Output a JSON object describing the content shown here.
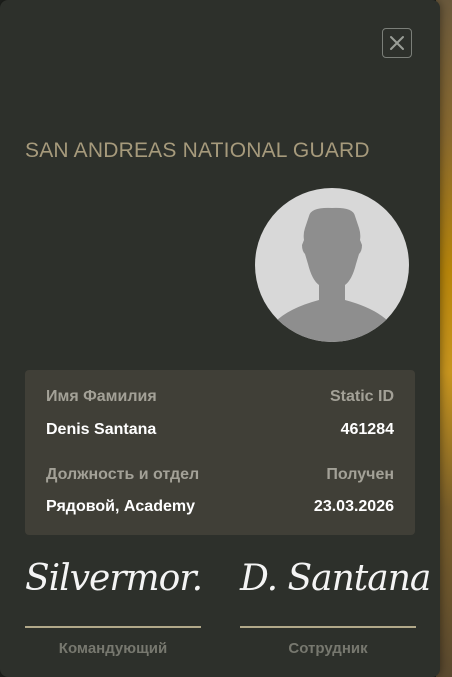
{
  "header": {
    "title": "SAN ANDREAS NATIONAL GUARD",
    "close_icon": "close-icon"
  },
  "photo": {
    "icon": "person-silhouette-icon"
  },
  "info": {
    "name_label": "Имя Фамилия",
    "name_value": "Denis Santana",
    "static_id_label": "Static ID",
    "static_id_value": "461284",
    "position_label": "Должность и отдел",
    "position_value": "Рядовой, Academy",
    "received_label": "Получен",
    "received_value": "23.03.2026"
  },
  "signatures": {
    "commander_signature": "Silvermor.",
    "commander_caption": "Командующий",
    "employee_signature": "D. Santana",
    "employee_caption": "Сотрудник"
  },
  "colors": {
    "card_bg": "#2d302b",
    "info_bg": "#403f37",
    "title": "#a69a7c",
    "accent_line": "#b1a889"
  }
}
